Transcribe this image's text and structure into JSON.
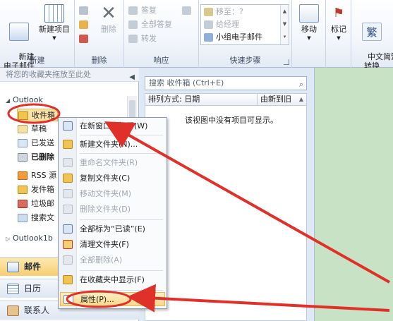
{
  "colors": {
    "accent": "#f7cf72",
    "annotation": "#e0302a",
    "reading_pane": "#c8e2c6"
  },
  "ribbon": {
    "new_group": {
      "label": "新建",
      "new_mail": "新建\n电子邮件",
      "new_items": "新建项目"
    },
    "delete_group": {
      "label": "删除",
      "delete": "删除"
    },
    "respond_group": {
      "label": "响应",
      "reply": "答复",
      "reply_all": "全部答复",
      "forward": "转发"
    },
    "quick_steps": {
      "label": "快速步骤",
      "items": [
        "移至：?",
        "给经理",
        "小组电子邮件"
      ]
    },
    "move_group": {
      "move": "移动"
    },
    "tags_group": {
      "tag": "标记"
    },
    "chinese_group": {
      "convert": "中文简繁\n转换"
    }
  },
  "folder_pane": {
    "favorites_hint": "将您的收藏夹拖放至此处",
    "accounts": [
      "Outlook",
      "Outlook1b"
    ],
    "folders": [
      "收件箱",
      "草稿",
      "已发送",
      "已删除",
      "RSS 源",
      "发件箱",
      "垃圾邮",
      "搜索文"
    ],
    "nav": {
      "mail": "邮件",
      "calendar": "日历",
      "contacts": "联系人"
    }
  },
  "message_list": {
    "search_placeholder": "搜索 收件箱 (Ctrl+E)",
    "sort_by": "排列方式: 日期",
    "order": "由新到旧",
    "empty": "该视图中没有项目可显示。"
  },
  "context_menu": {
    "items": [
      {
        "label": "在新窗口中打开(W)",
        "enabled": true
      },
      {
        "label": "新建文件夹(N)...",
        "enabled": true
      },
      {
        "label": "重命名文件夹(R)",
        "enabled": false
      },
      {
        "label": "复制文件夹(C)",
        "enabled": true
      },
      {
        "label": "移动文件夹(M)",
        "enabled": false
      },
      {
        "label": "删除文件夹(D)",
        "enabled": false
      },
      {
        "label": "全部标为“已读”(E)",
        "enabled": true
      },
      {
        "label": "清理文件夹(F)",
        "enabled": true
      },
      {
        "label": "全部删除(A)",
        "enabled": false
      },
      {
        "label": "在收藏夹中显示(F)",
        "enabled": true
      },
      {
        "label": "属性(P)...",
        "enabled": true
      }
    ]
  }
}
